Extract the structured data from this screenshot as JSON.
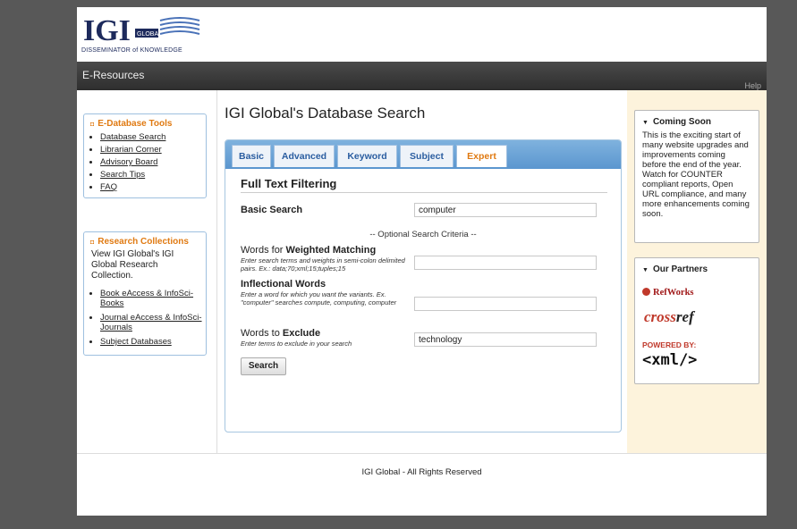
{
  "header": {
    "logo_text": "IGI",
    "logo_badge": "GLOBAL",
    "tagline": "DISSEMINATOR of KNOWLEDGE"
  },
  "topbar": {
    "title": "E-Resources",
    "help": "Help"
  },
  "left": {
    "tools": {
      "title": "E-Database Tools",
      "items": [
        "Database Search",
        "Librarian Corner",
        "Advisory Board",
        "Search Tips",
        "FAQ"
      ]
    },
    "collections": {
      "title": "Research Collections",
      "text": "View IGI Global's IGI Global Research Collection.",
      "items": [
        "Book eAccess & InfoSci-Books",
        "Journal eAccess & InfoSci-Journals",
        "Subject Databases"
      ]
    }
  },
  "center": {
    "title": "IGI Global's Database Search",
    "tabs": [
      "Basic",
      "Advanced",
      "Keyword",
      "Subject",
      "Expert"
    ],
    "active_tab": "Expert",
    "section_title": "Full Text Filtering",
    "basic_search": {
      "label": "Basic Search",
      "value": "computer"
    },
    "optional_label": "-- Optional Search Criteria --",
    "weighted": {
      "label_pre": "Words for ",
      "label_bold": "Weighted Matching",
      "hint": "Enter search terms and weights in semi-colon delimited pairs. Ex.: data;70;xml;15;tuples;15",
      "value": ""
    },
    "inflectional": {
      "label": "Inflectional Words",
      "hint": "Enter a word for which you want the variants. Ex. \"computer\" searches compute, computing, computer",
      "value": ""
    },
    "exclude": {
      "label_pre": "Words to ",
      "label_bold": "Exclude",
      "hint": "Enter terms to exclude in your search",
      "value": "technology"
    },
    "search_button": "Search"
  },
  "right": {
    "coming_soon": {
      "title": "Coming Soon",
      "text": "This is the exciting start of many website upgrades and improvements coming before the end of the year. Watch for COUNTER compliant reports, Open URL compliance, and many more enhancements coming soon."
    },
    "partners": {
      "title": "Our Partners",
      "refworks": "RefWorks",
      "crossref_a": "cross",
      "crossref_b": "ref",
      "powered_by": "POWERED BY:",
      "xml": "<xml/>"
    }
  },
  "footer": {
    "text": "IGI Global - All Rights Reserved"
  },
  "colors": {
    "accent": "#e07a12",
    "tab_bar": "#6aa3d7",
    "link_blue": "#2a5da0",
    "sidebar_right": "#fdf3dc"
  }
}
